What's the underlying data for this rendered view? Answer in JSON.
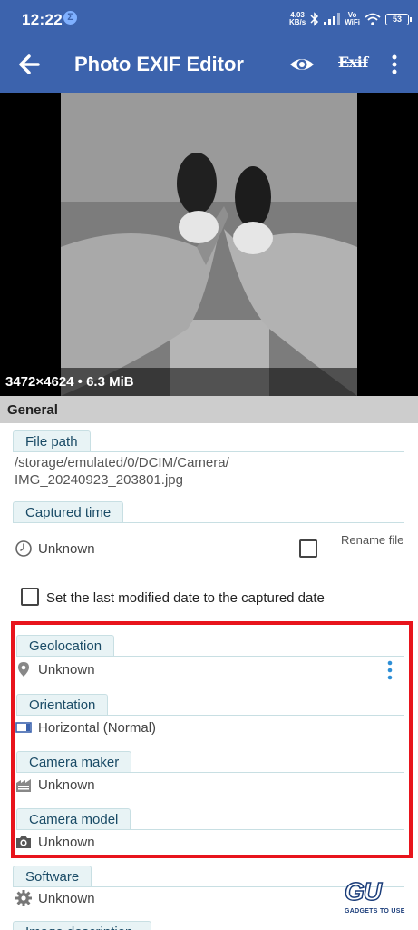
{
  "status_bar": {
    "time": "12:22",
    "app_badge": "Σ",
    "net_speed_value": "4.03",
    "net_speed_unit": "KB/s",
    "volte_label": "Vo",
    "wifi_label": "WiFi",
    "battery": "53"
  },
  "app_bar": {
    "title": "Photo EXIF Editor",
    "exif_label": "Exif"
  },
  "photo": {
    "dimensions": "3472×4624 • 6.3 MiB"
  },
  "general": {
    "header": "General",
    "file_path": {
      "label": "File path",
      "line1": "/storage/emulated/0/DCIM/Camera/",
      "line2": "IMG_20240923_203801.jpg"
    },
    "captured_time": {
      "label": "Captured time",
      "value": "Unknown",
      "rename_file": "Rename file"
    },
    "set_modified": "Set the last modified date to the captured date",
    "geolocation": {
      "label": "Geolocation",
      "value": "Unknown"
    },
    "orientation": {
      "label": "Orientation",
      "value": "Horizontal (Normal)"
    },
    "camera_maker": {
      "label": "Camera maker",
      "value": "Unknown"
    },
    "camera_model": {
      "label": "Camera model",
      "value": "Unknown"
    },
    "software": {
      "label": "Software",
      "value": "Unknown"
    },
    "next_label": "Image description"
  },
  "watermark": {
    "logo": "GU",
    "caption": "GADGETS TO USE"
  },
  "colors": {
    "app_bar": "#3c63ad",
    "highlight": "#e8141c",
    "tag_bg": "#e8f3f5",
    "accent_blue": "#2e8fd6"
  }
}
